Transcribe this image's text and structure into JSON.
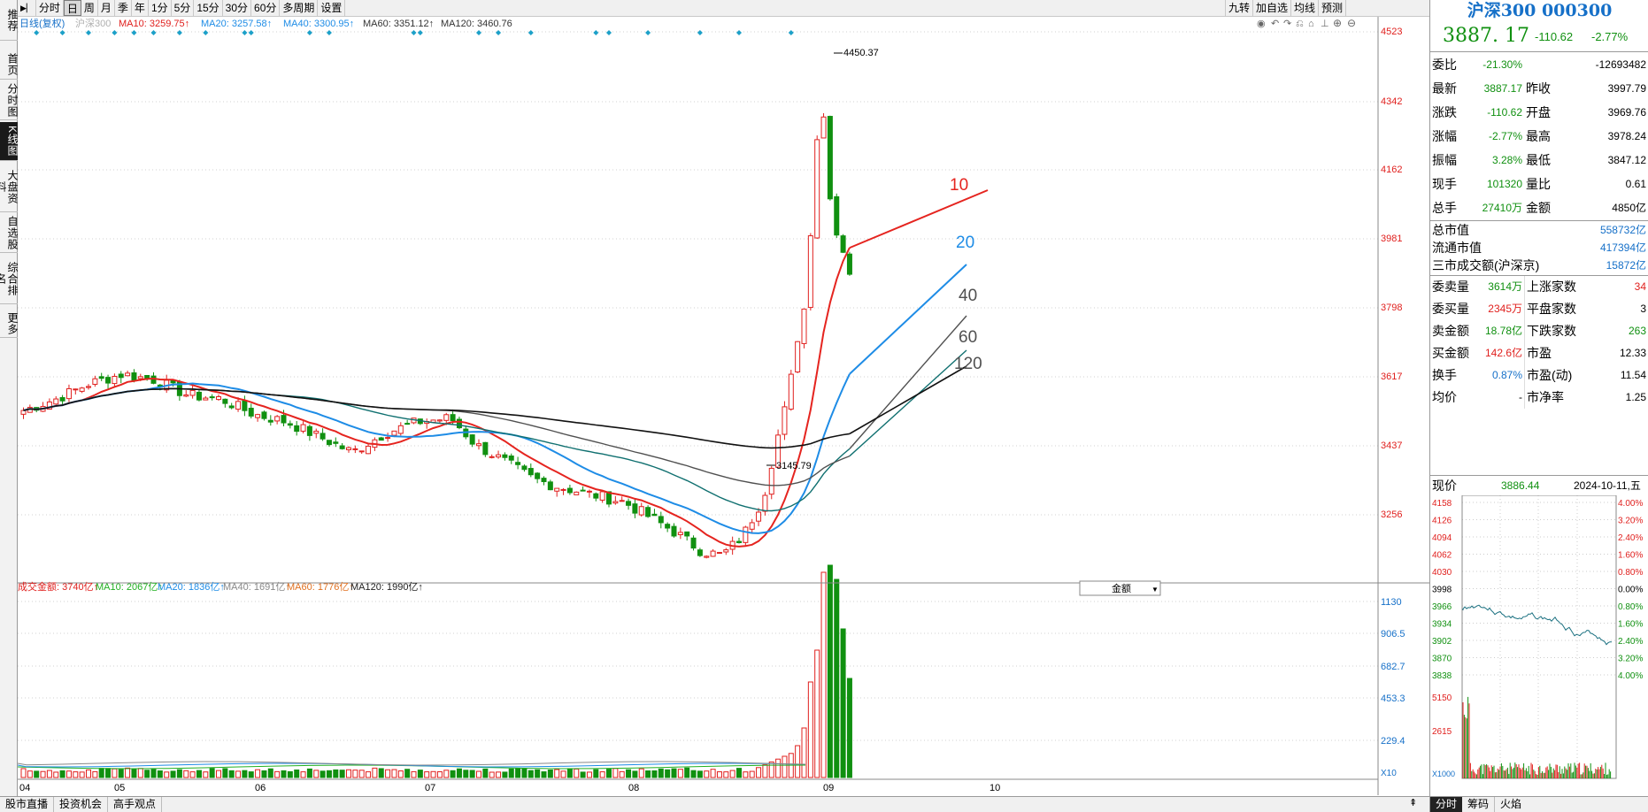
{
  "left_nav": [
    "推荐",
    "首页",
    "分时图",
    "K线图",
    "大盘资料",
    "自选股",
    "综合排名",
    "更多"
  ],
  "left_nav_active": 3,
  "toolbar": {
    "items": [
      "分时",
      "日",
      "周",
      "月",
      "季",
      "年",
      "1分",
      "5分",
      "15分",
      "30分",
      "60分",
      "多周期",
      "设置"
    ],
    "active_index": 1,
    "right_items": [
      "九转",
      "加自选",
      "均线",
      "预测"
    ]
  },
  "legend": {
    "mode": "日线(复权)",
    "index": "沪深300",
    "ma10": "MA10: 3259.75↑",
    "ma20": "MA20: 3257.58↑",
    "ma40": "MA40: 3300.95↑",
    "ma60": "MA60: 3351.12↑",
    "ma120": "MA120: 3460.76"
  },
  "price_axis": [
    "4523",
    "4342",
    "4162",
    "3981",
    "3798",
    "3617",
    "3437",
    "3256"
  ],
  "high_label": "4450.37",
  "low_label": "3145.79",
  "ma_end_labels": [
    "10",
    "20",
    "40",
    "60",
    "120"
  ],
  "vol_legend": {
    "amount": "成交金额: 3740亿↑",
    "ma10": "MA10: 2067亿↑",
    "ma20": "MA20: 1836亿↑",
    "ma40": "MA40: 1691亿↑",
    "ma60": "MA60: 1776亿↑",
    "ma120": "MA120: 1990亿↑"
  },
  "vol_selector": "金额",
  "vol_axis": [
    "1130",
    "906.5",
    "682.7",
    "453.3",
    "229.4"
  ],
  "vol_unit": "X10",
  "month_labels": [
    "04",
    "05",
    "06",
    "07",
    "08",
    "09",
    "10"
  ],
  "bottom_tabs": [
    "股市直播",
    "投资机会",
    "高手观点"
  ],
  "colors": {
    "up": "#e0201e",
    "down": "#109010",
    "ma10": "#e5241f",
    "ma20": "#1e8ce6",
    "ma40": "#505050",
    "ma60": "#107070",
    "ma120": "#111111",
    "signal": "#1ca0c8"
  },
  "quote": {
    "title": "沪深300 000300",
    "price": "3887. 17",
    "change": "-110.62",
    "change_pct": "-2.77%",
    "rows": [
      {
        "k1": "委比",
        "v1": "-21.30%",
        "k2": "",
        "v2": "-12693482"
      },
      {
        "k1": "最新",
        "v1": "3887.17",
        "k2": "昨收",
        "v2": "3997.79"
      },
      {
        "k1": "涨跌",
        "v1": "-110.62",
        "k2": "开盘",
        "v2": "3969.76"
      },
      {
        "k1": "涨幅",
        "v1": "-2.77%",
        "k2": "最高",
        "v2": "3978.24"
      },
      {
        "k1": "振幅",
        "v1": "3.28%",
        "k2": "最低",
        "v2": "3847.12"
      },
      {
        "k1": "现手",
        "v1": "101320",
        "k2": "量比",
        "v2": "0.61"
      },
      {
        "k1": "总手",
        "v1": "27410万",
        "k2": "金额",
        "v2": "4850亿"
      }
    ],
    "mkt": [
      {
        "k": "总市值",
        "v": "558732亿"
      },
      {
        "k": "流通市值",
        "v": "417394亿"
      },
      {
        "k": "三市成交额(沪深京)",
        "v": "15872亿"
      }
    ],
    "stats": [
      {
        "k1": "委卖量",
        "v1": "3614万",
        "k2": "上涨家数",
        "v2": "34"
      },
      {
        "k1": "委买量",
        "v1": "2345万",
        "k2": "平盘家数",
        "v2": "3"
      },
      {
        "k1": "卖金额",
        "v1": "18.78亿",
        "k2": "下跌家数",
        "v2": "263"
      },
      {
        "k1": "买金额",
        "v1": "142.6亿",
        "k2": "市盈",
        "v2": "12.33"
      },
      {
        "k1": "换手",
        "v1": "0.87%",
        "k2": "市盈(动)",
        "v2": "11.54"
      },
      {
        "k1": "均价",
        "v1": "-",
        "k2": "市净率",
        "v2": "1.25"
      }
    ],
    "now_label": "现价",
    "now_value": "3886.44",
    "date": "2024-10-11,五"
  },
  "mini": {
    "price_axis": [
      "4158",
      "4126",
      "4094",
      "4062",
      "4030",
      "3998",
      "3966",
      "3934",
      "3902",
      "3870",
      "3838"
    ],
    "pct_axis": [
      "4.00%",
      "3.20%",
      "2.40%",
      "1.60%",
      "0.80%",
      "0.00%",
      "0.80%",
      "1.60%",
      "2.40%",
      "3.20%",
      "4.00%"
    ],
    "vol_axis": [
      "5150",
      "2615"
    ],
    "vol_unit": "X1000",
    "tabs": [
      "分时",
      "筹码",
      "火焰"
    ]
  }
}
